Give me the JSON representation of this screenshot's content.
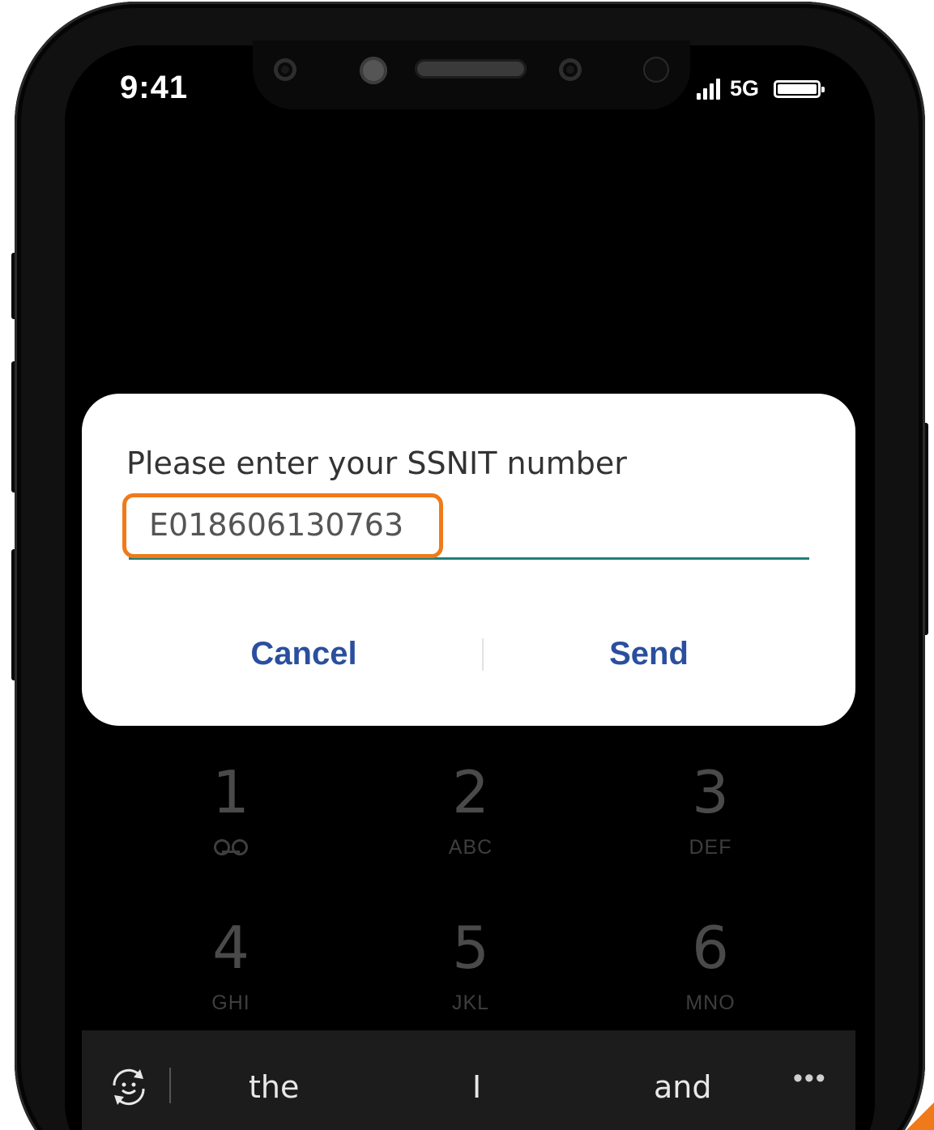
{
  "status_bar": {
    "time": "9:41",
    "network": "5G",
    "icons": [
      "signal-icon",
      "battery-icon"
    ]
  },
  "dialog": {
    "title": "Please enter your SSNIT number",
    "input_value": "E018606130763",
    "cancel_label": "Cancel",
    "send_label": "Send"
  },
  "keypad": {
    "keys": [
      {
        "digit": "1",
        "letters": ""
      },
      {
        "digit": "2",
        "letters": "ABC"
      },
      {
        "digit": "3",
        "letters": "DEF"
      },
      {
        "digit": "4",
        "letters": "GHI"
      },
      {
        "digit": "5",
        "letters": "JKL"
      },
      {
        "digit": "6",
        "letters": "MNO"
      }
    ],
    "voicemail_icon": "voicemail-icon"
  },
  "keyboard": {
    "suggestions": [
      "the",
      "I",
      "and"
    ],
    "icons": [
      "emoji-toggle-icon",
      "more-icon"
    ]
  },
  "colors": {
    "highlight": "#f07a1a",
    "button_text": "#2a4f9f",
    "input_underline": "#1f7f78"
  }
}
